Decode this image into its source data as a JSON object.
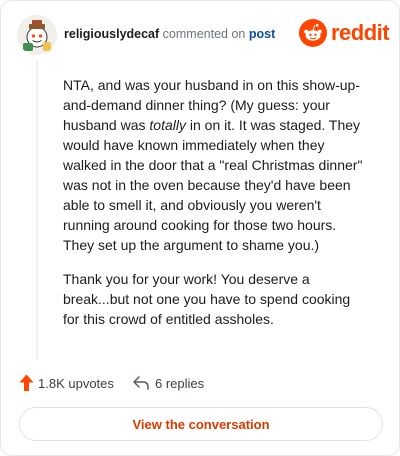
{
  "header": {
    "username": "religiouslydecaf",
    "action_text": "commented on",
    "post_link": "post",
    "brand": "reddit"
  },
  "comment": {
    "p1_before": "NTA, and was your husband in on this show-up-and-demand dinner thing? (My guess: your husband was ",
    "p1_emphasis": "totally",
    "p1_after": " in on it. It was staged. They would have known immediately when they walked in the door that a \"real Christmas dinner\" was not in the oven because they'd have been able to smell it, and obviously you weren't running around cooking for those two hours. They set up the argument to shame you.)",
    "p2": "Thank you for your work! You deserve a break...but not one you have to spend cooking for this crowd of entitled assholes."
  },
  "footer": {
    "upvotes": "1.8K upvotes",
    "replies": "6 replies"
  },
  "cta": {
    "label": "View the conversation"
  },
  "colors": {
    "brand_orange": "#ff4500",
    "cta_text": "#d93a00",
    "post_link": "#0b4fa3"
  },
  "icons": {
    "avatar": "snoo-avatar",
    "brand": "reddit-logo",
    "upvote": "upvote-arrow-icon",
    "reply": "reply-arrow-icon"
  }
}
